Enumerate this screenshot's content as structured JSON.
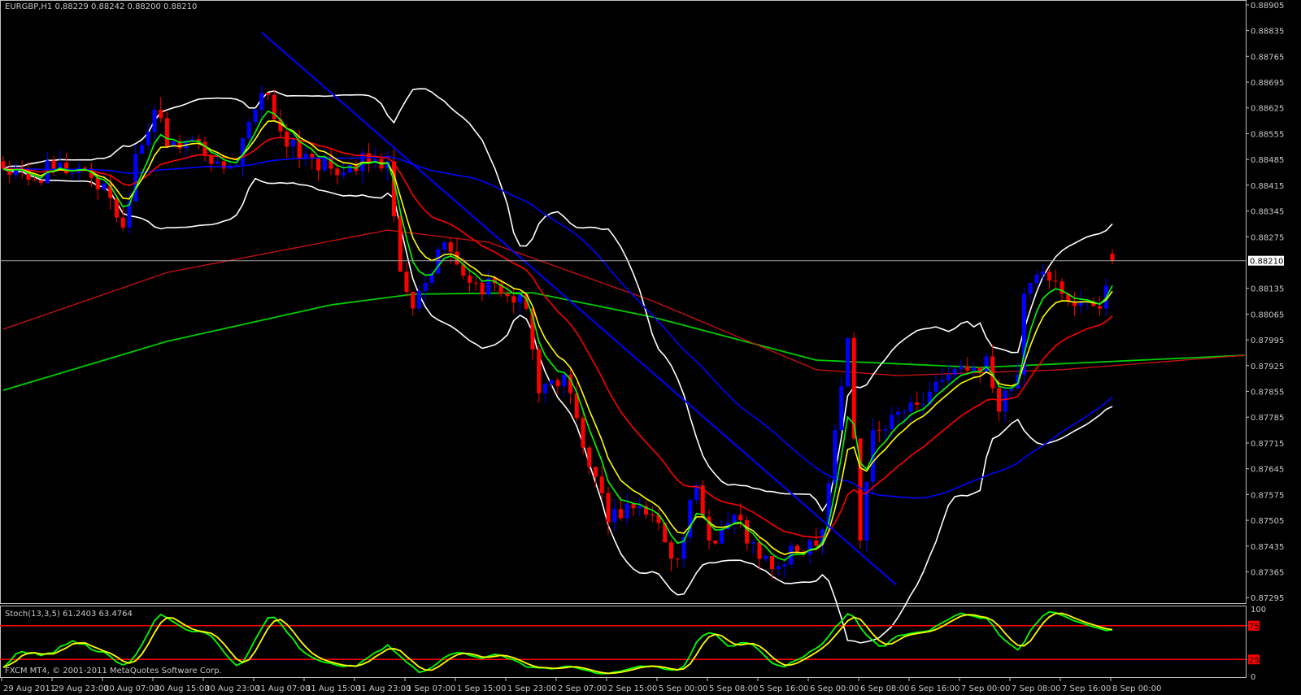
{
  "header": {
    "title": "EURGBP,H1  0.88229 0.88242 0.88200 0.88210"
  },
  "footer": {
    "copyright": "FXCM MT4, © 2001-2011 MetaQuotes Software Corp."
  },
  "colors": {
    "bull": "#0000ff",
    "bear": "#ff0000",
    "ema_fast": "#00ff00",
    "ema_mid": "#ffff00",
    "ma_red": "#ff0000",
    "ma_blue": "#0000ff",
    "bands": "#ffffff",
    "trendline": "#0000ff",
    "long_red": "#cc1111",
    "long_green": "#00cc00"
  },
  "chart_data": [
    {
      "type": "candlestick",
      "symbol": "EURGBP",
      "timeframe": "H1",
      "current_price": "0.88210",
      "ylim": [
        0.8728,
        0.88918
      ],
      "y_ticks": [
        "0.88905",
        "0.88835",
        "0.88765",
        "0.88695",
        "0.88625",
        "0.88555",
        "0.88485",
        "0.88415",
        "0.88345",
        "0.88275",
        "0.88135",
        "0.88065",
        "0.87995",
        "0.87925",
        "0.87855",
        "0.87785",
        "0.87715",
        "0.87645",
        "0.87575",
        "0.87505",
        "0.87435",
        "0.87365",
        "0.87295"
      ],
      "x_ticks": [
        "29 Aug 2011",
        "29 Aug 23:00",
        "30 Aug 07:00",
        "30 Aug 15:00",
        "30 Aug 23:00",
        "31 Aug 07:00",
        "31 Aug 15:00",
        "31 Aug 23:00",
        "1 Sep 07:00",
        "1 Sep 15:00",
        "1 Sep 23:00",
        "2 Sep 07:00",
        "2 Sep 15:00",
        "5 Sep 00:00",
        "5 Sep 08:00",
        "5 Sep 16:00",
        "6 Sep 00:00",
        "6 Sep 08:00",
        "6 Sep 16:00",
        "7 Sep 00:00",
        "7 Sep 08:00",
        "7 Sep 16:00",
        "8 Sep 00:00"
      ],
      "bars_per_tick": 8,
      "close_keypoints": [
        [
          0,
          0.8846
        ],
        [
          4,
          0.8843
        ],
        [
          8,
          0.8846
        ],
        [
          13,
          0.8846
        ],
        [
          17,
          0.8838
        ],
        [
          19,
          0.883
        ],
        [
          21,
          0.885
        ],
        [
          24,
          0.8862
        ],
        [
          26,
          0.8852
        ],
        [
          30,
          0.8854
        ],
        [
          34,
          0.8848
        ],
        [
          37,
          0.8847
        ],
        [
          40,
          0.8862
        ],
        [
          42,
          0.8866
        ],
        [
          45,
          0.8852
        ],
        [
          48,
          0.885
        ],
        [
          52,
          0.8846
        ],
        [
          55,
          0.8847
        ],
        [
          61,
          0.8848
        ],
        [
          63,
          0.8818
        ],
        [
          65,
          0.8808
        ],
        [
          67,
          0.8815
        ],
        [
          70,
          0.8826
        ],
        [
          72,
          0.882
        ],
        [
          75,
          0.8815
        ],
        [
          79,
          0.8812
        ],
        [
          83,
          0.8808
        ],
        [
          85,
          0.8785
        ],
        [
          89,
          0.879
        ],
        [
          93,
          0.8765
        ],
        [
          96,
          0.875
        ],
        [
          99,
          0.8755
        ],
        [
          103,
          0.8752
        ],
        [
          107,
          0.874
        ],
        [
          110,
          0.876
        ],
        [
          112,
          0.8745
        ],
        [
          116,
          0.8752
        ],
        [
          120,
          0.874
        ],
        [
          123,
          0.8738
        ],
        [
          126,
          0.8742
        ],
        [
          130,
          0.8748
        ],
        [
          132,
          0.8775
        ],
        [
          134,
          0.88
        ],
        [
          136,
          0.8745
        ],
        [
          138,
          0.8775
        ],
        [
          142,
          0.878
        ],
        [
          146,
          0.8782
        ],
        [
          150,
          0.879
        ],
        [
          154,
          0.8792
        ],
        [
          156,
          0.8795
        ],
        [
          158,
          0.878
        ],
        [
          161,
          0.879
        ],
        [
          162,
          0.8812
        ],
        [
          165,
          0.8818
        ],
        [
          168,
          0.8812
        ],
        [
          172,
          0.881
        ],
        [
          174,
          0.8808
        ],
        [
          176,
          0.8821
        ]
      ],
      "long_ma_red": [
        [
          0,
          0.88024
        ],
        [
          26,
          0.88178
        ],
        [
          61,
          0.88293
        ],
        [
          77,
          0.8826
        ],
        [
          103,
          0.88101
        ],
        [
          129,
          0.87914
        ],
        [
          142,
          0.87898
        ],
        [
          168,
          0.87914
        ],
        [
          197,
          0.87953
        ]
      ],
      "long_ma_green": [
        [
          0,
          0.87858
        ],
        [
          26,
          0.87991
        ],
        [
          52,
          0.8809
        ],
        [
          65,
          0.88119
        ],
        [
          84,
          0.88123
        ],
        [
          103,
          0.88057
        ],
        [
          129,
          0.8794
        ],
        [
          155,
          0.8792
        ],
        [
          197,
          0.87953
        ]
      ],
      "trendline": [
        [
          41,
          0.8883
        ],
        [
          141.7,
          0.8733
        ]
      ]
    },
    {
      "type": "line",
      "title": "Stoch(13,3,5) 61.2403 63.4764",
      "ylim": [
        0,
        100
      ],
      "levels": [
        "75",
        "25"
      ],
      "y_ticks": [
        "100",
        "0"
      ]
    }
  ]
}
